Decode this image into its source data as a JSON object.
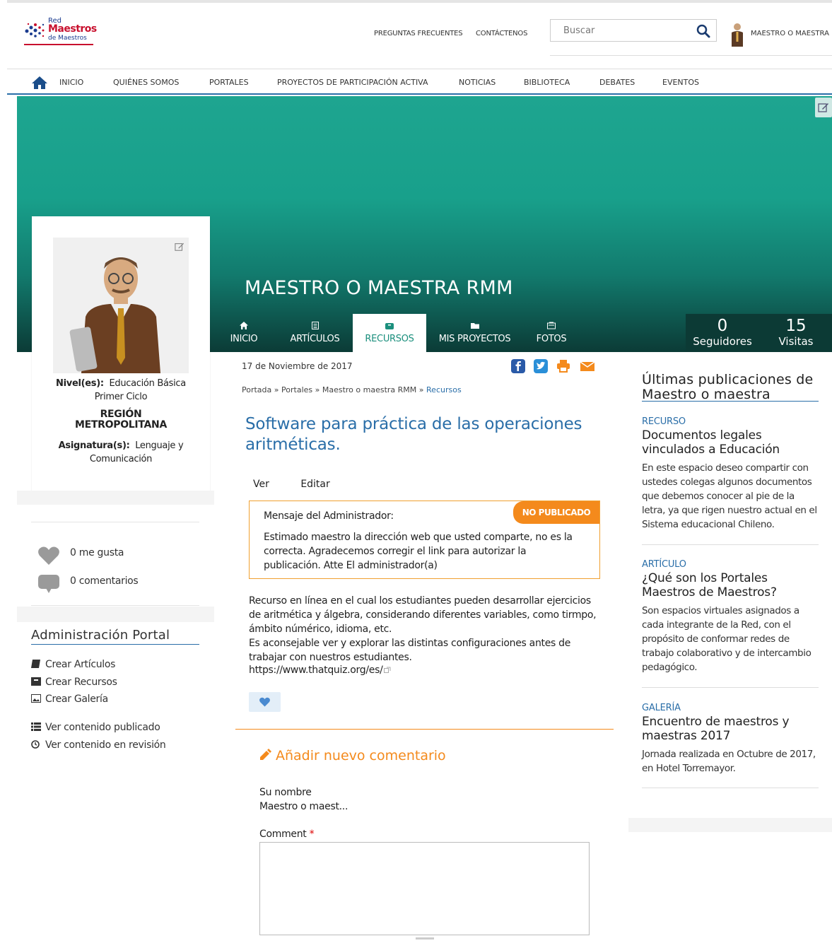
{
  "logo": {
    "line1": "Red",
    "line2": "Maestros",
    "line3": "de Maestros"
  },
  "header": {
    "faq": "PREGUNTAS FRECUENTES",
    "contact": "CONTÁCTENOS",
    "search_placeholder": "Buscar",
    "username": "MAESTRO O MAESTRA ..."
  },
  "nav": {
    "items": [
      "INICIO",
      "QUIÉNES SOMOS",
      "PORTALES",
      "PROYECTOS DE PARTICIPACIÓN ACTIVA",
      "NOTICIAS",
      "BIBLIOTECA",
      "DEBATES",
      "EVENTOS"
    ]
  },
  "banner": {
    "title": "MAESTRO O MAESTRA RMM"
  },
  "tabs": [
    {
      "label": "INICIO",
      "icon": "home-icon"
    },
    {
      "label": "ARTÍCULOS",
      "icon": "article-icon"
    },
    {
      "label": "RECURSOS",
      "icon": "resource-icon"
    },
    {
      "label": "MIS PROYECTOS",
      "icon": "folder-icon"
    },
    {
      "label": "FOTOS",
      "icon": "photo-icon"
    }
  ],
  "stats": {
    "followers_count": "0",
    "followers_label": "Seguidores",
    "visits_count": "15",
    "visits_label": "Visitas"
  },
  "profile": {
    "levels_label": "Nivel(es):",
    "levels_value": "Educación Básica Primer Ciclo",
    "region": "REGIÓN METROPOLITANA",
    "subject_label": "Asignatura(s):",
    "subject_value": "Lenguaje y Comunicación"
  },
  "social": {
    "likes": "0 me gusta",
    "comments": "0 comentarios"
  },
  "admin": {
    "title": "Administración Portal",
    "links": [
      "Crear Artículos",
      "Crear Recursos",
      "Crear Galería",
      "Ver contenido publicado",
      "Ver contenido en revisión"
    ]
  },
  "article": {
    "date": "17 de Noviembre de 2017",
    "breadcrumb": [
      "Portada",
      "Portales",
      "Maestro o maestra RMM",
      "Recursos"
    ],
    "title": "Software para práctica de las operaciones aritméticas.",
    "view_tab": "Ver",
    "edit_tab": "Editar",
    "status_badge": "NO PUBLICADO",
    "admin_msg_title": "Mensaje del Administrador:",
    "admin_msg_body": "Estimado maestro la dirección web que usted comparte, no es la correcta. Agradecemos corregir el link para autorizar la publicación. Atte El administrador(a)",
    "body": "Recurso en línea en el cual los estudiantes pueden desarrollar ejercicios de aritmética y álgebra, considerando diferentes variables, como tirmpo, ámbito númérico, idioma, etc.\nEs aconsejable ver y explorar las distintas configuraciones antes de trabajar con nuestros estudiantes.",
    "link": "https://www.thatquiz.org/es/"
  },
  "comment_form": {
    "heading": "Añadir nuevo comentario",
    "name_label": "Su nombre",
    "name_value": "Maestro o maest...",
    "comment_label": "Comment",
    "required_mark": "*"
  },
  "latest": {
    "title": "Últimas publicaciones de Maestro o maestra",
    "items": [
      {
        "type": "RECURSO",
        "title": "Documentos legales vinculados a Educación",
        "desc": "En este espacio deseo compartir con ustedes colegas algunos documentos que debemos conocer al pie de la letra, ya que rigen nuestro actual en el Sistema educacional Chileno."
      },
      {
        "type": "ARTÍCULO",
        "title": "¿Qué son los Portales Maestros de Maestros?",
        "desc": "Son espacios virtuales asignados a cada integrante de la Red, con el propósito de conformar redes de trabajo colaborativo y de intercambio pedagógico."
      },
      {
        "type": "GALERÍA",
        "title": "Encuentro de maestros y maestras 2017",
        "desc": "Jornada realizada en Octubre de 2017, en Hotel Torremayor."
      }
    ]
  },
  "colors": {
    "teal": "#1ea590",
    "blue": "#2a6ea8",
    "orange": "#f48a1c",
    "dark": "#0c3a35"
  }
}
